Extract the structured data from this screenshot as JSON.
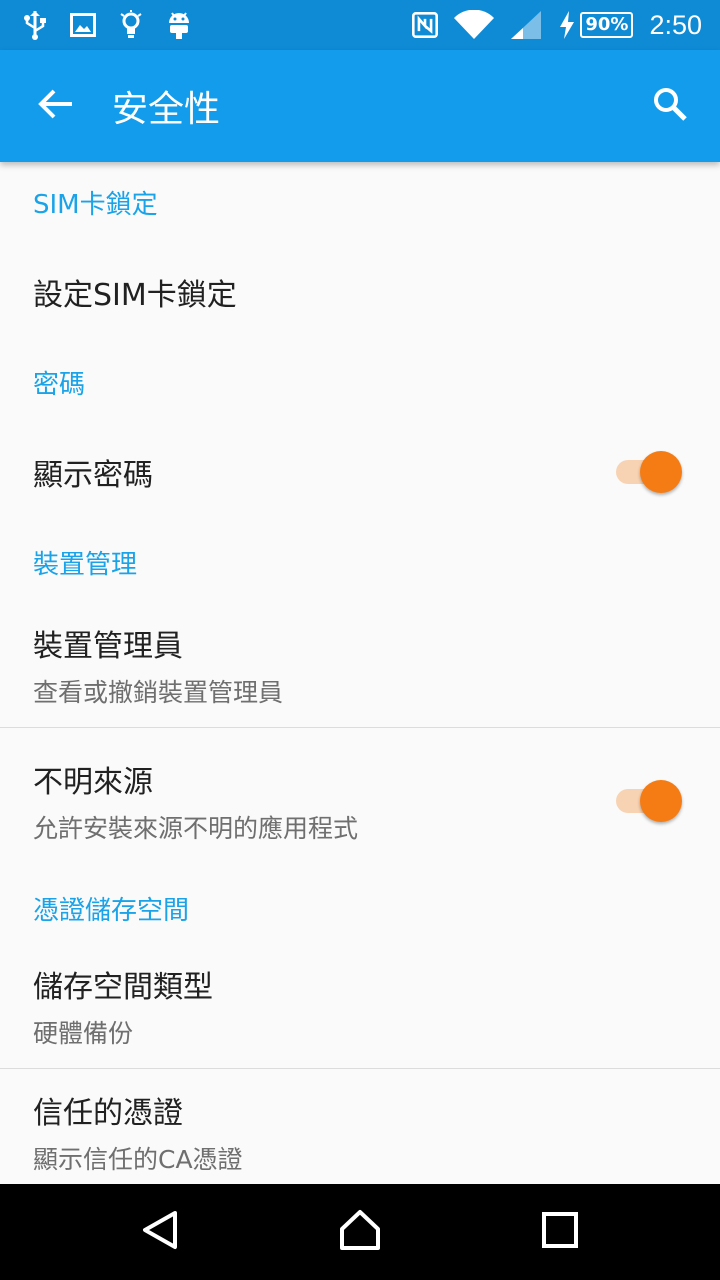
{
  "status_bar": {
    "battery": "90%",
    "time": "2:50"
  },
  "app_bar": {
    "title": "安全性"
  },
  "sections": {
    "sim": {
      "header": "SIM卡鎖定",
      "item_title": "設定SIM卡鎖定"
    },
    "password": {
      "header": "密碼",
      "item_title": "顯示密碼",
      "toggle_on": true
    },
    "device_admin": {
      "header": "裝置管理",
      "admins_title": "裝置管理員",
      "admins_sub": "查看或撤銷裝置管理員",
      "unknown_title": "不明來源",
      "unknown_sub": "允許安裝來源不明的應用程式",
      "unknown_toggle_on": true
    },
    "credentials": {
      "header": "憑證儲存空間",
      "storage_title": "儲存空間類型",
      "storage_sub": "硬體備份",
      "trusted_title": "信任的憑證",
      "trusted_sub": "顯示信任的CA憑證"
    }
  },
  "colors": {
    "status_bar": "#0f8bd6",
    "app_bar": "#139ceb",
    "section_header": "#1aa3e8",
    "toggle_thumb": "#f57c14",
    "toggle_track": "#f8d3b3"
  },
  "icons": {
    "status_left": [
      "usb-icon",
      "image-icon",
      "lightbulb-icon",
      "android-icon"
    ],
    "status_right": [
      "nfc-icon",
      "wifi-icon",
      "signal-icon",
      "charging-icon"
    ],
    "app_bar": [
      "back-arrow-icon",
      "search-icon"
    ],
    "nav": [
      "back-triangle-icon",
      "home-icon",
      "recents-icon"
    ]
  }
}
